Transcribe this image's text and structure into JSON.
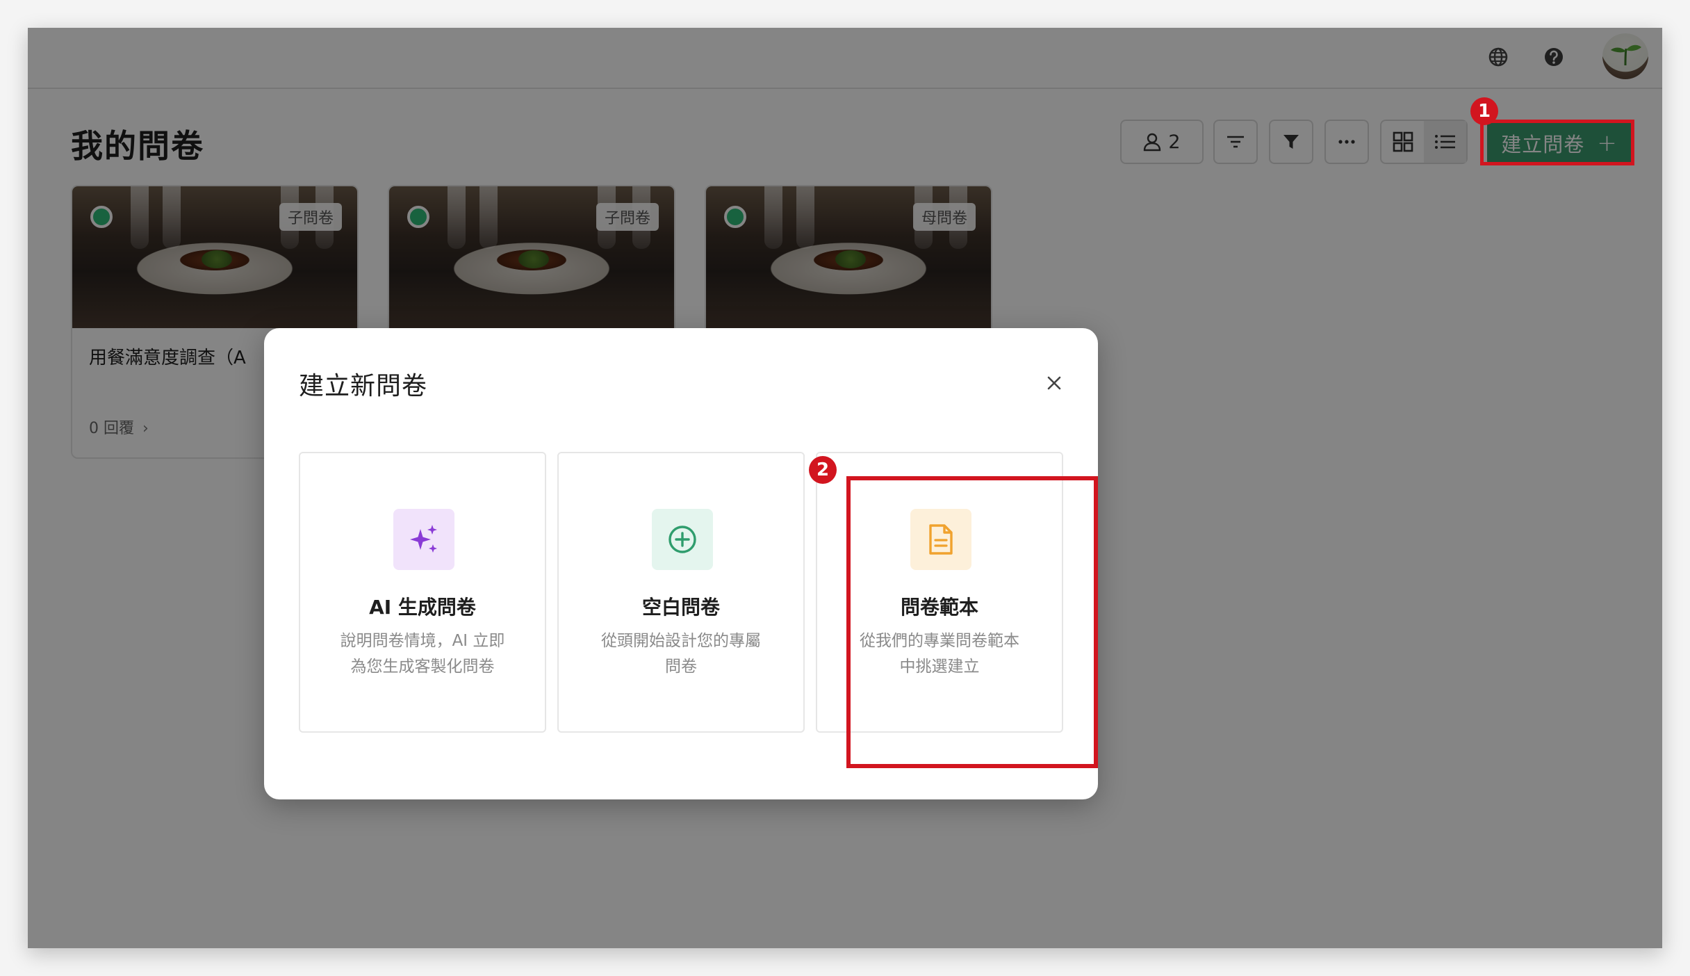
{
  "topbar": {
    "language_icon": "globe-icon",
    "help_icon": "help-circle-icon",
    "avatar_icon": "sprout-avatar"
  },
  "page": {
    "title": "我的問卷"
  },
  "toolbar": {
    "member_count": "2",
    "member_icon": "person-icon",
    "sort_icon": "sort-icon",
    "filter_icon": "filter-icon",
    "more_icon": "more-icon",
    "grid_view_icon": "grid-view-icon",
    "list_view_icon": "list-view-icon",
    "create_label": "建立問卷",
    "create_plus": "+"
  },
  "annotations": {
    "badge1": "1",
    "badge2": "2",
    "color": "#d2151f"
  },
  "cards": [
    {
      "tag": "子問卷",
      "title": "用餐滿意度調查（A",
      "replies": "0 回覆"
    },
    {
      "tag": "子問卷"
    },
    {
      "tag": "母問卷"
    }
  ],
  "modal": {
    "title": "建立新問卷",
    "close_icon": "close-icon",
    "options": [
      {
        "title": "AI 生成問卷",
        "desc_line1": "說明問卷情境，AI 立即",
        "desc_line2": "為您生成客製化問卷",
        "icon": "sparkles-icon",
        "icon_bg": "#f1e3fb",
        "icon_color": "#8a3bd6"
      },
      {
        "title": "空白問卷",
        "desc_line1": "從頭開始設計您的專屬",
        "desc_line2": "問卷",
        "icon": "plus-circle-icon",
        "icon_bg": "#e4f5ee",
        "icon_color": "#2f9d6d"
      },
      {
        "title": "問卷範本",
        "desc_line1": "從我們的專業問卷範本",
        "desc_line2": "中挑選建立",
        "icon": "document-icon",
        "icon_bg": "#fdf0da",
        "icon_color": "#f0a22e"
      }
    ]
  },
  "colors": {
    "primary_green": "#3a9a6e",
    "status_green": "#2ebc7a"
  }
}
